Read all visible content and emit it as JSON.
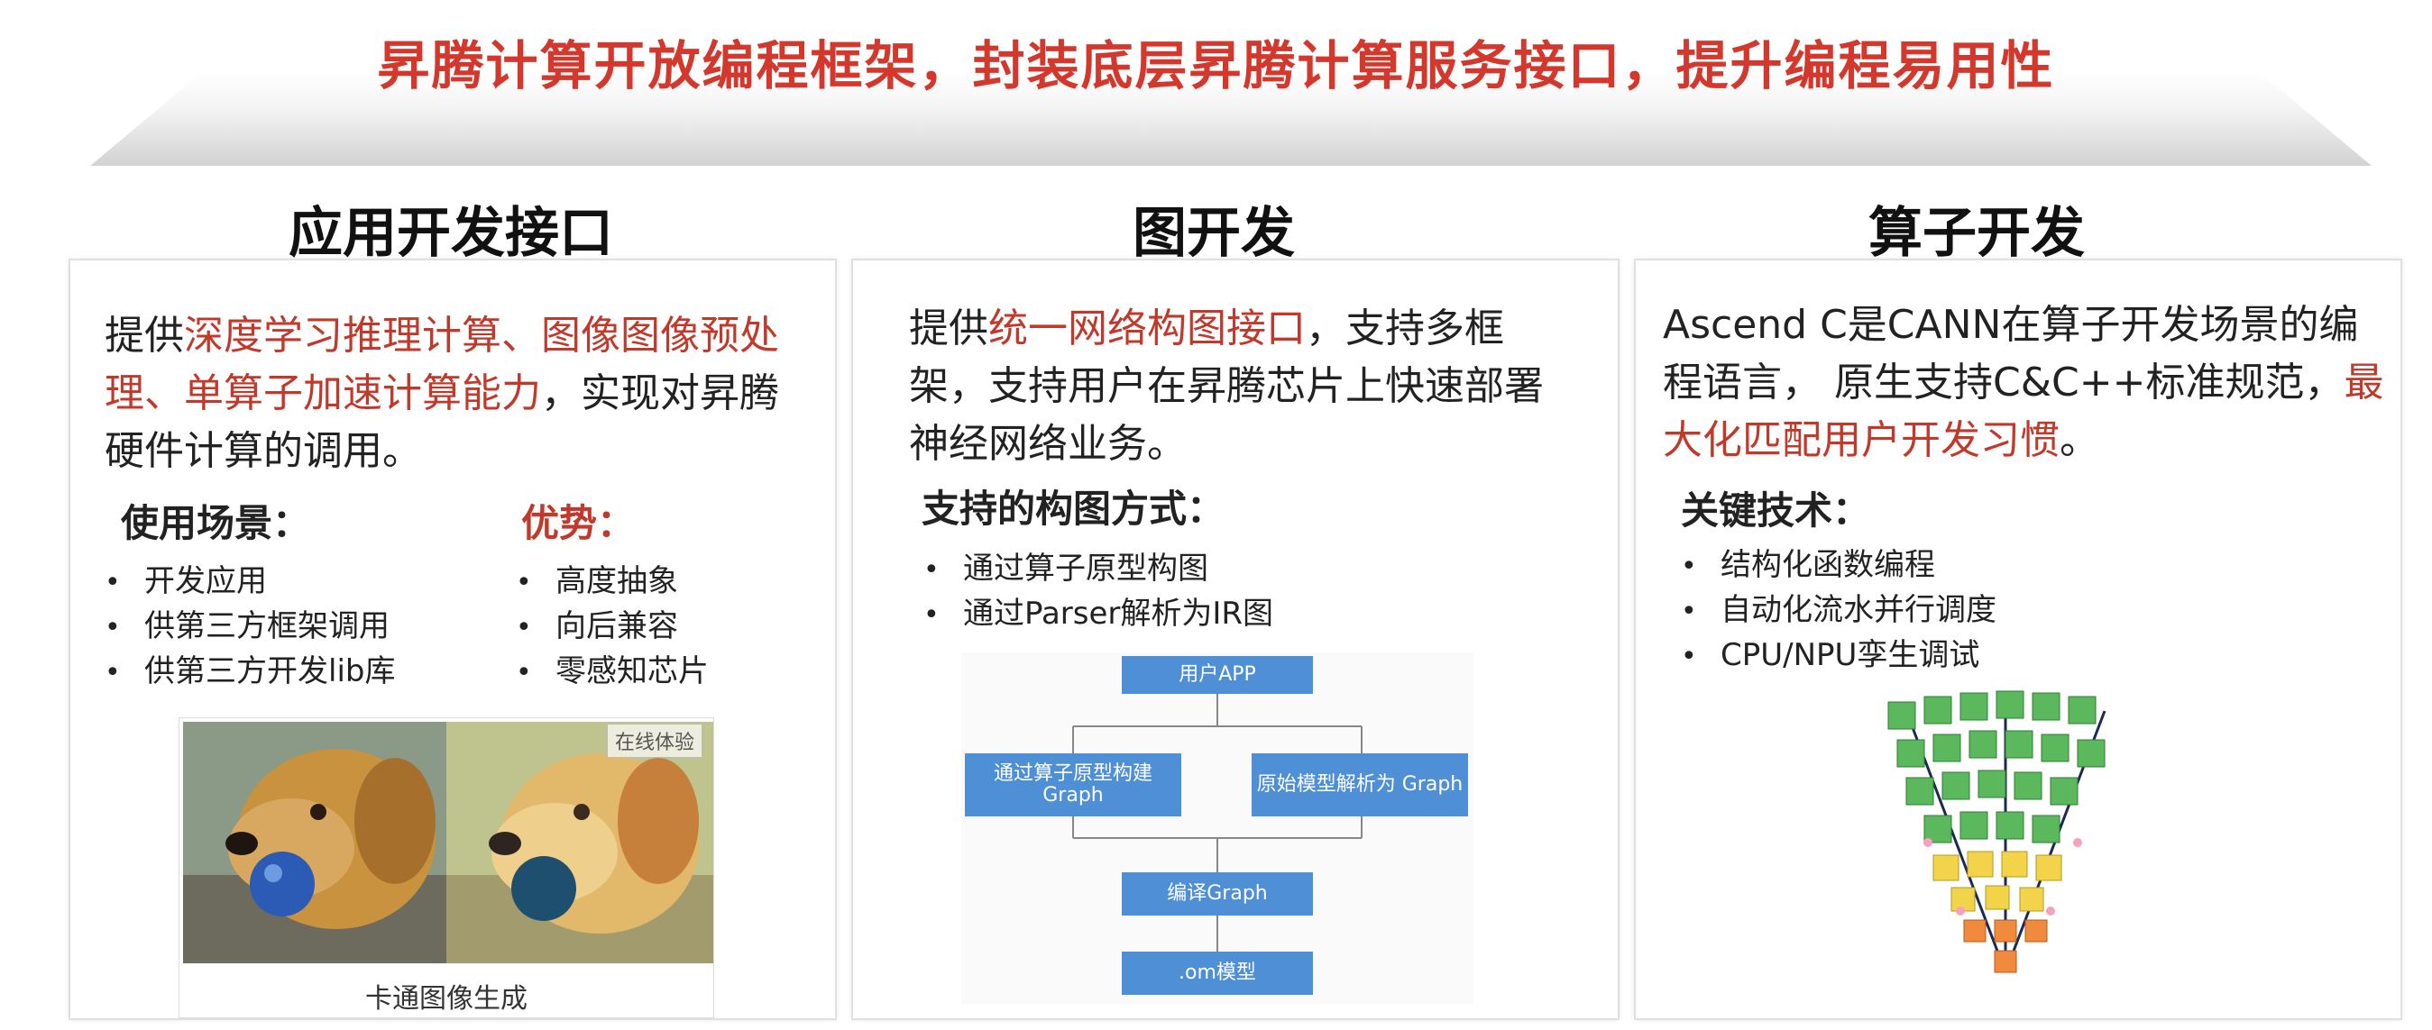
{
  "banner": {
    "title": "昇腾计算开放编程框架，封装底层昇腾计算服务接口，提升编程易用性"
  },
  "col1": {
    "title": "应用开发接口",
    "desc": {
      "p1": "提供",
      "h1": "深度学习推理计算、图像图像预处理、单算子加速计算能力",
      "p2": "，实现对昇腾硬件计算的调用。"
    },
    "usage_title": "使用场景：",
    "usage": [
      "开发应用",
      "供第三方框架调用",
      "供第三方开发lib库"
    ],
    "adv_title": "优势：",
    "advantages": [
      "高度抽象",
      "向后兼容",
      "零感知芯片"
    ],
    "image_caption": "卡通图像生成",
    "image_badge": "在线体验"
  },
  "col2": {
    "title": "图开发",
    "desc": {
      "p1": "提供",
      "h1": "统一网络构图接口",
      "p2": "，支持多框架，支持用户在昇腾芯片上快速部署神经网络业务。"
    },
    "methods_title": "支持的构图方式：",
    "methods": [
      "通过算子原型构图",
      "通过Parser解析为IR图"
    ],
    "flow": {
      "top": "用户APP",
      "left": "通过算子原型构建 Graph",
      "right": "原始模型解析为 Graph",
      "mid": "编译Graph",
      "bottom": ".om模型"
    }
  },
  "col3": {
    "title": "算子开发",
    "desc": {
      "p1": "Ascend C是CANN在算子开发场景的编程语言， 原生支持C&C++标准规范，",
      "h1": "最大化匹配用户开发习惯",
      "p2": "。"
    },
    "tech_title": "关键技术：",
    "tech": [
      "结构化函数编程",
      "自动化流水并行调度",
      "CPU/NPU孪生调试"
    ]
  },
  "colors": {
    "accent_red": "#d4382c",
    "flow_blue": "#4f8fd6"
  }
}
